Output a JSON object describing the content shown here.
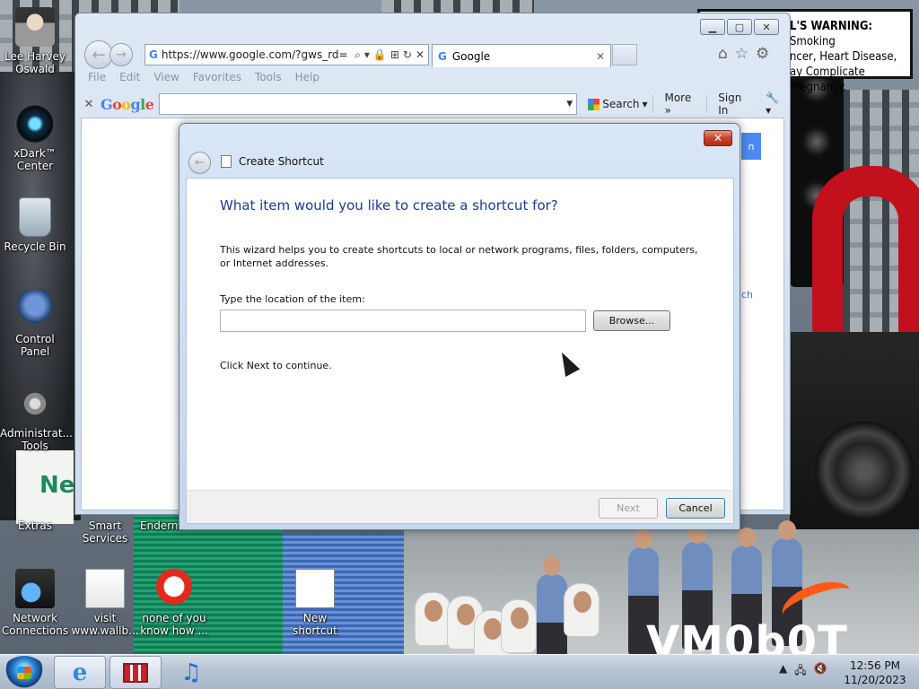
{
  "desktop": {
    "icons": [
      {
        "label": "Lee Harvey Oswald",
        "icon": "portrait-icon"
      },
      {
        "label": "xDark™ Center",
        "icon": "xdark-center-icon"
      },
      {
        "label": "Recycle Bin",
        "icon": "recycle-bin-icon"
      },
      {
        "label": "Control Panel",
        "icon": "control-panel-icon"
      },
      {
        "label": "Administrat... Tools",
        "icon": "admin-tools-icon"
      },
      {
        "label": "Extras",
        "icon": "extras-icon"
      },
      {
        "label": "Smart Services",
        "icon": "smart-services-icon"
      },
      {
        "label": "Enderm",
        "icon": "enderm-icon"
      },
      {
        "label": "Network Connections",
        "icon": "network-icon"
      },
      {
        "label": "visit www.wallb...",
        "icon": "document-icon"
      },
      {
        "label": "none of you know how ...",
        "icon": "red-file-icon"
      },
      {
        "label": "New shortcut",
        "icon": "shortcut-icon"
      }
    ],
    "wallpaper": {
      "warning_sign": {
        "line1_bold": "L'S WARNING:",
        "line1_rest": "Smoking",
        "line2": "ncer, Heart Disease,",
        "line3": "ay Complicate Pregnancy."
      },
      "brand_text": "VM0b0T",
      "sign_letters": "Ne"
    }
  },
  "browser": {
    "url": "https://www.google.com/?gws_rd=",
    "tab_title": "Google",
    "menu": [
      "File",
      "Edit",
      "View",
      "Favorites",
      "Tools",
      "Help"
    ],
    "toolbar": {
      "logo": "Google",
      "search_label": "Search",
      "more_label": "More »",
      "signin_label": "Sign In"
    },
    "content": {
      "button_fragment": "n",
      "link_fragment": "ch"
    }
  },
  "dialog": {
    "title": "Create Shortcut",
    "heading": "What item would you like to create a shortcut for?",
    "description": "This wizard helps you to create shortcuts to local or network programs, files, folders, computers, or Internet addresses.",
    "location_label": "Type the location of the item:",
    "location_value": "",
    "browse_label": "Browse...",
    "continue_text": "Click Next to continue.",
    "next_label": "Next",
    "cancel_label": "Cancel"
  },
  "taskbar": {
    "clock_time": "12:56 PM",
    "clock_date": "11/20/2023"
  },
  "colors": {
    "dialog_heading": "#1d3a8a",
    "google_blue": "#4285f4",
    "close_red": "#c7412b"
  }
}
